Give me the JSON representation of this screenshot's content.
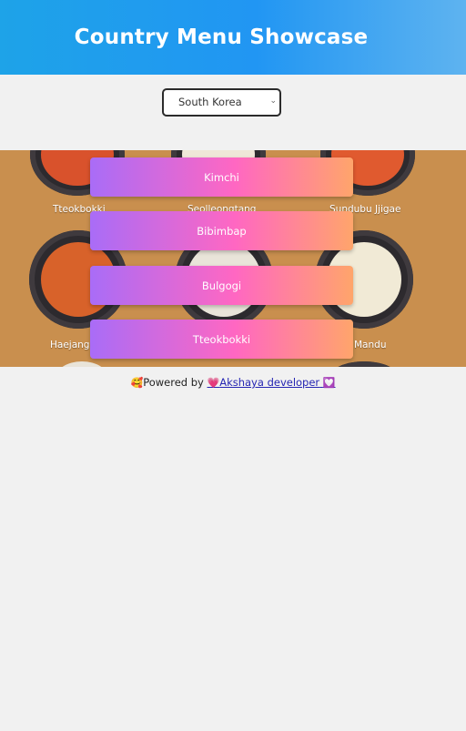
{
  "header": {
    "title": "Country Menu Showcase"
  },
  "country_select": {
    "selected": "South Korea"
  },
  "banner": {
    "food_labels": [
      "Tteokbokki",
      "Seolleongtang",
      "Sundubu Jjigae",
      "Haejangguk",
      "Mandu"
    ]
  },
  "menu": {
    "items": [
      "Kimchi",
      "Bibimbap",
      "Bulgogi",
      "Tteokbokki"
    ]
  },
  "footer": {
    "prefix_emoji": "🥰",
    "powered_by": "Powered by",
    "heart_emoji": "💗",
    "author": "Akshaya developer",
    "suffix_emoji": "💟"
  },
  "colors": {
    "header_gradient_start": "#1ea3e8",
    "header_gradient_end": "#5eb3f0",
    "button_gradient": [
      "#a96cf7",
      "#ff67c2",
      "#ffa56b"
    ],
    "banner_bg": "#c98f4e",
    "page_bg": "#f1f1f1"
  }
}
